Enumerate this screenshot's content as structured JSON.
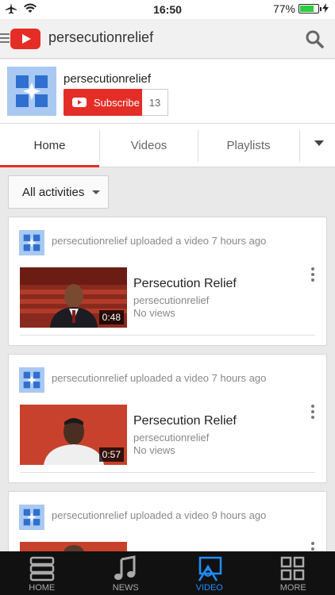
{
  "status": {
    "time": "16:50",
    "battery": "77%",
    "battery_level": 0.77
  },
  "appbar": {
    "title": "persecutionrelief"
  },
  "channel": {
    "name": "persecutionrelief",
    "subscribe_label": "Subscribe",
    "subscriber_count": "13"
  },
  "tabs": [
    {
      "label": "Home"
    },
    {
      "label": "Videos"
    },
    {
      "label": "Playlists"
    }
  ],
  "filter": {
    "label": "All activities"
  },
  "feed": [
    {
      "activity": "persecutionrelief uploaded a video 7 hours ago",
      "title": "Persecution Relief",
      "channel": "persecutionrelief",
      "views": "No views",
      "duration": "0:48"
    },
    {
      "activity": "persecutionrelief uploaded a video 7 hours ago",
      "title": "Persecution Relief",
      "channel": "persecutionrelief",
      "views": "No views",
      "duration": "0:57"
    },
    {
      "activity": "persecutionrelief uploaded a video 9 hours ago",
      "title": "",
      "channel": "",
      "views": "",
      "duration": ""
    }
  ],
  "bottom_nav": [
    {
      "label": "HOME",
      "icon": "home-list-icon"
    },
    {
      "label": "NEWS",
      "icon": "music-note-icon"
    },
    {
      "label": "VIDEO",
      "icon": "video-broadcast-icon"
    },
    {
      "label": "MORE",
      "icon": "grid-icon"
    }
  ],
  "colors": {
    "accent": "#e52d27",
    "active_nav": "#1f8fff",
    "avatar": "#a9c9f2"
  }
}
